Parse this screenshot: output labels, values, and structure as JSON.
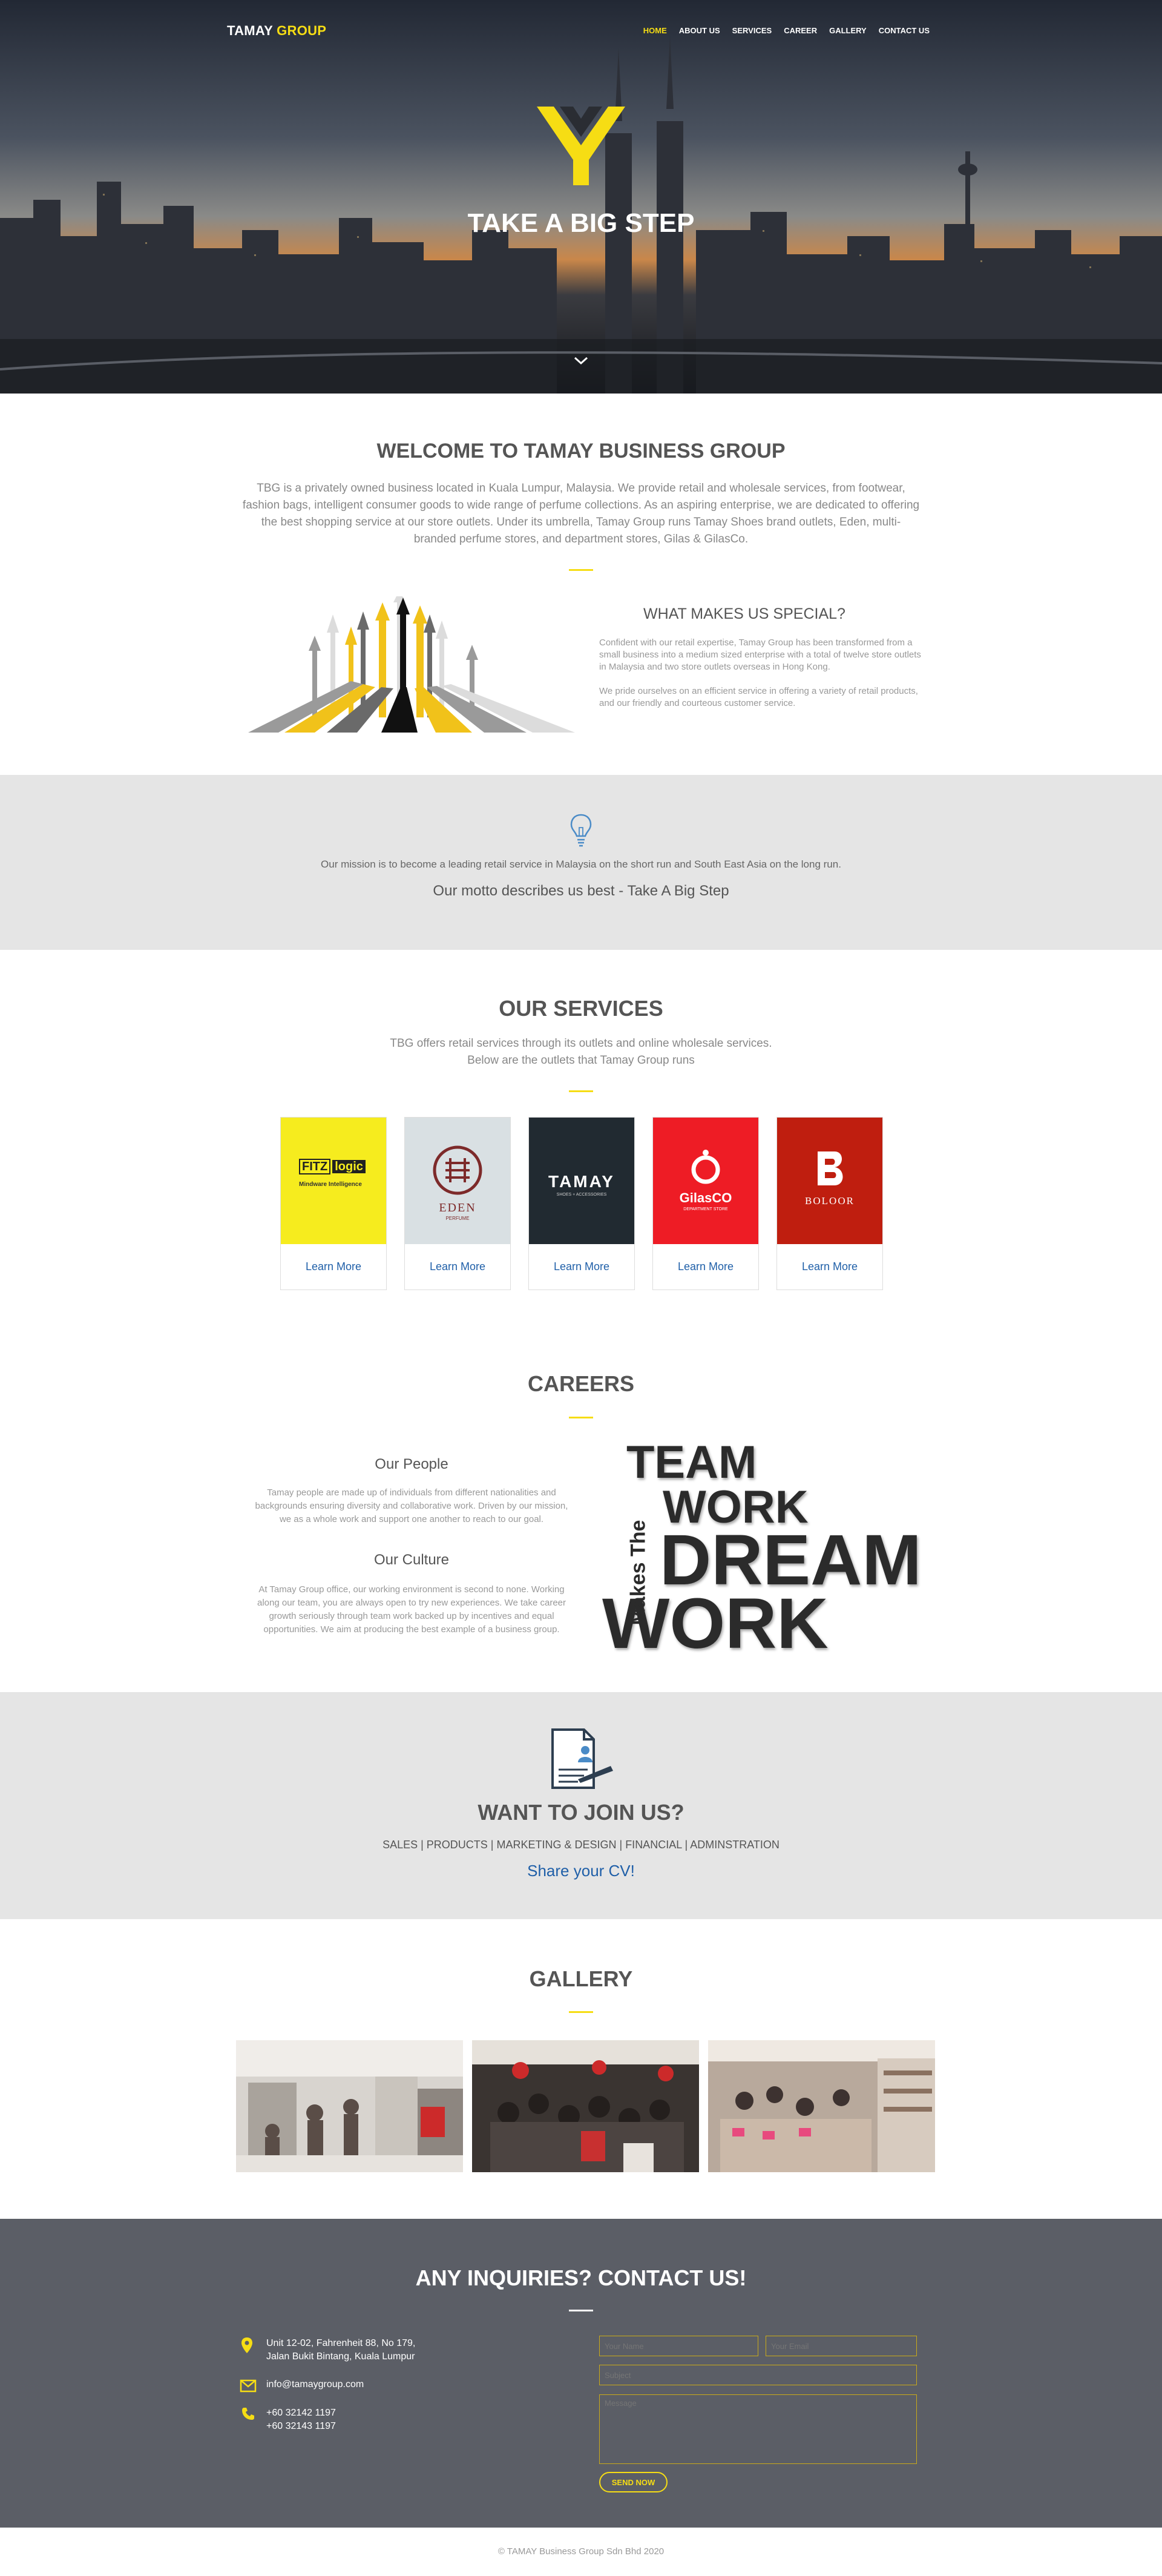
{
  "nav": {
    "brand_part1": "TAMAY",
    "brand_part2": "GROUP",
    "items": [
      {
        "label": "HOME",
        "active": true
      },
      {
        "label": "ABOUT US"
      },
      {
        "label": "SERVICES"
      },
      {
        "label": "CAREER"
      },
      {
        "label": "GALLERY"
      },
      {
        "label": "CONTACT US"
      }
    ]
  },
  "hero": {
    "title": "TAKE A BIG STEP",
    "scroll_icon": "chevron-down-icon"
  },
  "welcome": {
    "title": "WELCOME TO TAMAY BUSINESS GROUP",
    "text": "TBG is a privately owned business located in Kuala Lumpur, Malaysia. We provide retail and wholesale services, from footwear, fashion bags, intelligent consumer goods to wide range of perfume collections. As an aspiring enterprise, we are dedicated to offering the best shopping service at our store outlets. Under its umbrella, Tamay Group runs Tamay Shoes brand outlets, Eden, multi-branded perfume stores, and department stores, Gilas & GilasCo.",
    "special_title": "WHAT MAKES US SPECIAL?",
    "special_text": "Confident with our retail expertise, Tamay Group has been transformed from a small business into a medium sized enterprise with a total of twelve store outlets in Malaysia and two store outlets overseas in Hong Kong.",
    "special_text2": "We pride ourselves on an efficient service in offering a variety of retail products, and our friendly and courteous customer service."
  },
  "mission": {
    "icon": "lightbulb-icon",
    "text": "Our mission is to become a leading retail service in Malaysia on the short run and South East Asia on the long run.",
    "motto": "Our motto describes us best - Take A Big Step"
  },
  "services": {
    "title": "OUR SERVICES",
    "line1": "TBG offers retail services through its outlets and online wholesale services.",
    "line2": "Below are the outlets that Tamay Group runs",
    "cards": [
      {
        "name": "Fitz Logic",
        "logo_line1": "FITZ",
        "logo_line2": "logic",
        "logo_sub": "Mindware Intelligence",
        "bg": "#f6ec1e",
        "learn": "Learn More"
      },
      {
        "name": "Eden",
        "logo_line1": "EDEN",
        "logo_sub": "PERFUME",
        "bg": "#d9e0e3",
        "learn": "Learn More"
      },
      {
        "name": "Tamay",
        "logo_line1": "TAMAY",
        "logo_sub": "SHOES + ACCESSORIES",
        "bg": "#212a31",
        "learn": "Learn More"
      },
      {
        "name": "Gilasco",
        "logo_line1": "GilasCO",
        "logo_sub": "DEPARTMENT STORE",
        "bg": "#ee1c25",
        "learn": "Learn More"
      },
      {
        "name": "Boloor",
        "logo_line1": "BOLOOR",
        "bg": "#bf1e0f",
        "learn": "Learn More"
      }
    ]
  },
  "careers": {
    "title": "CAREERS",
    "people_title": "Our People",
    "people_text": "Tamay people are made up of individuals from different nationalities and backgrounds ensuring diversity and collaborative work. Driven by our mission, we as a whole work and support one another to reach to our goal.",
    "culture_title": "Our Culture",
    "culture_text": "At Tamay Group office, our working environment is second to none. Working along our team, you are always open to try new experiences. We take career growth seriously through team work backed up by incentives and equal opportunities. We aim at producing the best example of a business group.",
    "poster": {
      "w1": "TEAM",
      "w2": "WORK",
      "w3": "DREAM",
      "w4": "WORK",
      "side": "Makes The"
    }
  },
  "join": {
    "icon": "cv-document-icon",
    "title": "WANT TO JOIN US?",
    "departments": "SALES | PRODUCTS | MARKETING & DESIGN | FINANCIAL | ADMINSTRATION",
    "cta": "Share your CV!"
  },
  "gallery": {
    "title": "GALLERY",
    "photos": [
      "store-photo-1",
      "store-photo-2",
      "store-photo-3"
    ]
  },
  "contact": {
    "title": "ANY INQUIRIES? CONTACT US!",
    "address1": "Unit 12-02, Fahrenheit 88, No 179,",
    "address2": "Jalan Bukit Bintang, Kuala Lumpur",
    "email": "info@tamaygroup.com",
    "phone1": "+60 32142 1197",
    "phone2": "+60 32143 1197",
    "ph_name": "Your Name",
    "ph_email": "Your Email",
    "ph_subject": "Subject",
    "ph_message": "Message",
    "send": "SEND NOW"
  },
  "footer": {
    "copyright": "© TAMAY Business Group Sdn Bhd 2020"
  },
  "colors": {
    "accent": "#f6dd14",
    "link": "#1f5fa8",
    "footer_bg": "#5b5e66",
    "band_bg": "#e5e5e5"
  }
}
